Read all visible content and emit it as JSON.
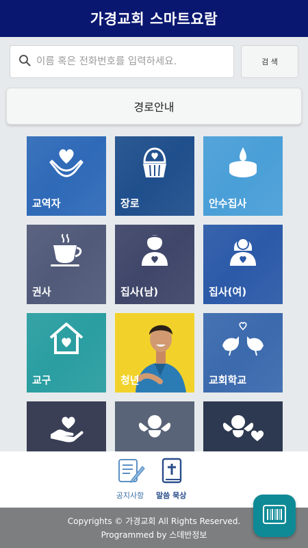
{
  "header": {
    "title": "가경교회 스마트요람"
  },
  "search": {
    "placeholder": "이름 혹은 전화번호를 입력하세요.",
    "value": "",
    "button_label": "검 색"
  },
  "route": {
    "label": "경로안내"
  },
  "tiles": [
    {
      "label": "교역자",
      "icon": "hands-heart-icon",
      "color": "#2f6ab8"
    },
    {
      "label": "장로",
      "icon": "cupcake-heart-icon",
      "color": "#1f4f8c"
    },
    {
      "label": "안수집사",
      "icon": "candle-icon",
      "color": "#4a9fd8"
    },
    {
      "label": "권사",
      "icon": "teacup-icon",
      "color": "#515a79"
    },
    {
      "label": "집사(남)",
      "icon": "man-heart-icon",
      "color": "#3f4669"
    },
    {
      "label": "집사(여)",
      "icon": "woman-heart-icon",
      "color": "#2c5aa8"
    },
    {
      "label": "교구",
      "icon": "house-heart-icon",
      "color": "#2a9ea1"
    },
    {
      "label": "청년",
      "icon": "young-man-photo",
      "color": "#f2d22a"
    },
    {
      "label": "교회학교",
      "icon": "lovebirds-icon",
      "color": "#3b6aad"
    },
    {
      "label": "",
      "icon": "hand-heart-icon",
      "color": "#3a3f55"
    },
    {
      "label": "",
      "icon": "cherub-icon",
      "color": "#5a6478"
    },
    {
      "label": "",
      "icon": "cherub-heart-icon",
      "color": "#2d3950"
    }
  ],
  "nav": [
    {
      "label": "공지사항",
      "icon": "notepad-pencil-icon"
    },
    {
      "label": "말씀 묵상",
      "icon": "bible-icon"
    }
  ],
  "footer": {
    "line1": "Copyrights © 가경교회 All Rights Reserved.",
    "line2": "Programmed by 스데반정보"
  },
  "fab": {
    "icon": "barcode-icon"
  }
}
